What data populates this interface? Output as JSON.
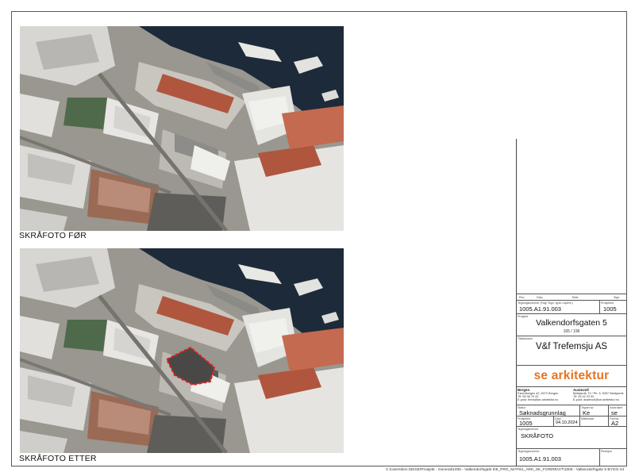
{
  "photos": {
    "before_caption": "SKRÅFOTO FØR",
    "after_caption": "SKRÅFOTO ETTER"
  },
  "title_block": {
    "revision_headers": [
      "Rev.",
      "Dato",
      "Tekst",
      "Sign."
    ],
    "drawing_number_label": "Tegningsnummer (Fag/ Tegn. type/ Løpenr.)",
    "drawing_number": "1005.A1.91.003",
    "project_number_label": "Prosjektnr.",
    "project_number": "1005",
    "project_label": "Prosjekt",
    "project_name": "Valkendorfsgaten 5",
    "gnr_bnr": "165 / 196",
    "client_label": "Tiltakshaver",
    "client": "V&f Trefemsju AS",
    "company": "se arkitektur",
    "office_1": {
      "name": "Bergen",
      "lines": [
        "Fantoftvegen 42, 5072 Bergen",
        "Tlf: 55 96 70 20",
        "E-post: firma@se-arkitektur.no"
      ]
    },
    "office_2": {
      "name": "Austevoll",
      "lines": [
        "Bekkjarvik 70 / Pb. 5, 5397 Bekkjarvik",
        "Tlf: 45 42 23 30",
        "E-post: austevoll@se-arkitektur.no"
      ]
    },
    "status_label": "Status",
    "status": "Søknadsgrunnlag",
    "drawn_by_label": "Tegnet av",
    "drawn_by": "Ke",
    "checked_label": "Kontrollert",
    "checked_by": "se",
    "project_no_label_2": "Prosjektnr.",
    "project_no_2": "1005",
    "date_label": "Dato",
    "date": "04.10.2024",
    "scale_label": "Målestokk",
    "format_label": "Format",
    "format": "A2",
    "drawing_title_label": "Tegningsinnhold",
    "drawing_title": "SKRÅFOTO",
    "drawing_number_label_2": "Tegningsnummer",
    "drawing_number_2": "1005.A1.91.003",
    "revision_label": "Revisjon"
  },
  "file_path": "C:\\Users\\kim.SEISE\\Prosjekt - General\\1005 - Valkendorfsgate 5\\6_PRO_MAT\\61_ARK_SK_FORIREVIT\\1005 - Valkendorfsgate 5 BYGG.rvt",
  "colors": {
    "logo_orange": "#e8731f",
    "marker_red": "#e02020",
    "water": "#1d2a3a",
    "roof_red": "#b0563e"
  }
}
